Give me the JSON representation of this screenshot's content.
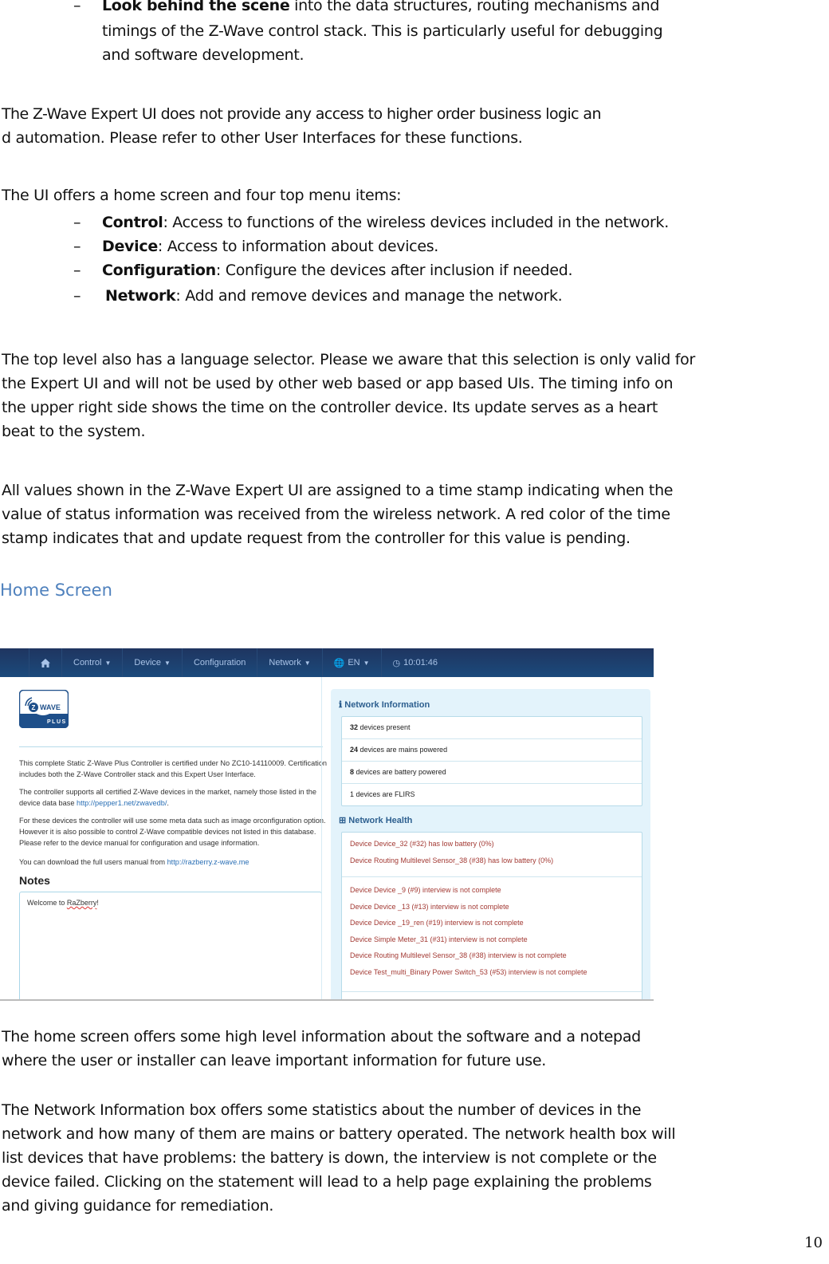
{
  "doc": {
    "bullet_top": {
      "bold": "Look behind the scene",
      "lines": [
        " into the data structures, routing mechanisms and",
        "timings of the Z-Wave control stack. This is particularly useful for debugging",
        "and software development."
      ]
    },
    "para1": [
      "The Z-Wave Expert UI does not provide any access to higher order business logic an",
      "d automation. Please refer to other User Interfaces for these functions."
    ],
    "para2_intro": "The UI offers a home screen and four top menu items:",
    "menu_bullets": [
      {
        "bold": "Control",
        "text": ": Access to functions of the wireless devices included in the network."
      },
      {
        "bold": "Device",
        "text": ": Access to information about devices."
      },
      {
        "bold": "Configuration",
        "text": ": Configure the devices after inclusion if needed."
      },
      {
        "bold": "Network",
        "text": ": Add and remove devices and manage the network."
      }
    ],
    "para3": [
      "The top level also has a language selector. Please we aware that this selection is only valid for",
      "the Expert UI and will not be used by other web based or app based UIs. The timing info on",
      "the upper right side shows the time on the controller device. Its update serves as a heart",
      "beat to the system."
    ],
    "para4": [
      "All values shown in the Z-Wave Expert UI are assigned to a time stamp indicating when the",
      "value of status information was received from the wireless network. A red color of the time",
      "stamp indicates that and update request from the controller for this value is pending."
    ],
    "section_heading": "Home Screen",
    "para5": [
      "The home screen offers some high level information about the software and a notepad",
      "where the user or installer can leave important information for future use."
    ],
    "para6": [
      "The Network Information box offers some statistics about the number of devices in the",
      "network and how many of them are mains or battery operated.  The network health box will",
      "list devices that have problems: the battery is down, the interview is not complete or the",
      "device failed. Clicking on the statement will lead to a help page explaining the problems",
      "and giving guidance for remediation."
    ],
    "page_number": "10"
  },
  "screenshot": {
    "nav": {
      "home_icon": "home-icon",
      "items": [
        {
          "label": "Control",
          "dropdown": true
        },
        {
          "label": "Device",
          "dropdown": true
        },
        {
          "label": "Configuration",
          "dropdown": false
        },
        {
          "label": "Network",
          "dropdown": true
        },
        {
          "label": "EN",
          "dropdown": true,
          "icon": "globe-icon"
        },
        {
          "label": "10:01:46",
          "dropdown": false,
          "icon": "clock-icon"
        }
      ]
    },
    "logo": {
      "top": "WAVE",
      "bottom": "PLUS"
    },
    "intro": [
      {
        "text": "This complete Static Z-Wave Plus Controller is certified under No ZC10-14110009. Certification includes both the Z-Wave Controller stack and this Expert User Interface."
      },
      {
        "text": "The controller supports all certified Z-Wave devices in the market, namely those listed in the device data base ",
        "link": "http://pepper1.net/zwavedb/",
        "after": "."
      },
      {
        "text": "For these devices the controller will use some meta data such as image orconfiguration option. However it is also possible to control Z-Wave compatible devices not listed in this database. Please refer to the device manual for configuration and usage information."
      },
      {
        "text": "You can download the full users manual from ",
        "link": "http://razberry.z-wave.me",
        "after": ""
      }
    ],
    "notes": {
      "title": "Notes",
      "prefix": "Welcome to ",
      "word": "RaZberry",
      "suffix": "!"
    },
    "network_info": {
      "title": "Network Information",
      "items": [
        {
          "count": "32",
          "text": " devices present"
        },
        {
          "count": "24",
          "text": " devices are mains powered"
        },
        {
          "count": "8",
          "text": " devices are battery powered"
        },
        {
          "count": "1",
          "text": " devices are FLIRS"
        }
      ]
    },
    "network_health": {
      "title": "Network Health",
      "battery": [
        "Device Device_32 (#32) has low battery (0%)",
        "Device Routing Multilevel Sensor_38 (#38) has low battery (0%)"
      ],
      "interview": [
        "Device Device _9 (#9) interview is not complete",
        "Device Device _13 (#13) interview is not complete",
        "Device Device _19_ren (#19) interview is not complete",
        "Device Simple Meter_31 (#31) interview is not complete",
        "Device Routing Multilevel Sensor_38 (#38) interview is not complete",
        "Device Test_multi_Binary Power Switch_53 (#53) interview is not complete"
      ]
    },
    "colors": {
      "nav": "#1f3f6e",
      "health_text": "#a33a34",
      "link": "#2a6fb5",
      "heading": "#4f81bd"
    }
  }
}
